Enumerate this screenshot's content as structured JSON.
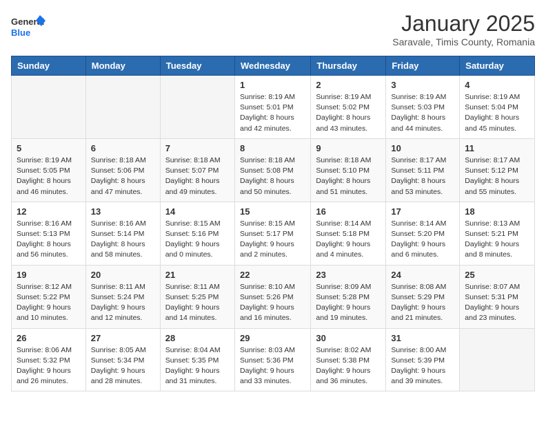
{
  "logo": {
    "general": "General",
    "blue": "Blue"
  },
  "title": "January 2025",
  "subtitle": "Saravale, Timis County, Romania",
  "weekdays": [
    "Sunday",
    "Monday",
    "Tuesday",
    "Wednesday",
    "Thursday",
    "Friday",
    "Saturday"
  ],
  "weeks": [
    [
      {
        "day": "",
        "info": ""
      },
      {
        "day": "",
        "info": ""
      },
      {
        "day": "",
        "info": ""
      },
      {
        "day": "1",
        "info": "Sunrise: 8:19 AM\nSunset: 5:01 PM\nDaylight: 8 hours and 42 minutes."
      },
      {
        "day": "2",
        "info": "Sunrise: 8:19 AM\nSunset: 5:02 PM\nDaylight: 8 hours and 43 minutes."
      },
      {
        "day": "3",
        "info": "Sunrise: 8:19 AM\nSunset: 5:03 PM\nDaylight: 8 hours and 44 minutes."
      },
      {
        "day": "4",
        "info": "Sunrise: 8:19 AM\nSunset: 5:04 PM\nDaylight: 8 hours and 45 minutes."
      }
    ],
    [
      {
        "day": "5",
        "info": "Sunrise: 8:19 AM\nSunset: 5:05 PM\nDaylight: 8 hours and 46 minutes."
      },
      {
        "day": "6",
        "info": "Sunrise: 8:18 AM\nSunset: 5:06 PM\nDaylight: 8 hours and 47 minutes."
      },
      {
        "day": "7",
        "info": "Sunrise: 8:18 AM\nSunset: 5:07 PM\nDaylight: 8 hours and 49 minutes."
      },
      {
        "day": "8",
        "info": "Sunrise: 8:18 AM\nSunset: 5:08 PM\nDaylight: 8 hours and 50 minutes."
      },
      {
        "day": "9",
        "info": "Sunrise: 8:18 AM\nSunset: 5:10 PM\nDaylight: 8 hours and 51 minutes."
      },
      {
        "day": "10",
        "info": "Sunrise: 8:17 AM\nSunset: 5:11 PM\nDaylight: 8 hours and 53 minutes."
      },
      {
        "day": "11",
        "info": "Sunrise: 8:17 AM\nSunset: 5:12 PM\nDaylight: 8 hours and 55 minutes."
      }
    ],
    [
      {
        "day": "12",
        "info": "Sunrise: 8:16 AM\nSunset: 5:13 PM\nDaylight: 8 hours and 56 minutes."
      },
      {
        "day": "13",
        "info": "Sunrise: 8:16 AM\nSunset: 5:14 PM\nDaylight: 8 hours and 58 minutes."
      },
      {
        "day": "14",
        "info": "Sunrise: 8:15 AM\nSunset: 5:16 PM\nDaylight: 9 hours and 0 minutes."
      },
      {
        "day": "15",
        "info": "Sunrise: 8:15 AM\nSunset: 5:17 PM\nDaylight: 9 hours and 2 minutes."
      },
      {
        "day": "16",
        "info": "Sunrise: 8:14 AM\nSunset: 5:18 PM\nDaylight: 9 hours and 4 minutes."
      },
      {
        "day": "17",
        "info": "Sunrise: 8:14 AM\nSunset: 5:20 PM\nDaylight: 9 hours and 6 minutes."
      },
      {
        "day": "18",
        "info": "Sunrise: 8:13 AM\nSunset: 5:21 PM\nDaylight: 9 hours and 8 minutes."
      }
    ],
    [
      {
        "day": "19",
        "info": "Sunrise: 8:12 AM\nSunset: 5:22 PM\nDaylight: 9 hours and 10 minutes."
      },
      {
        "day": "20",
        "info": "Sunrise: 8:11 AM\nSunset: 5:24 PM\nDaylight: 9 hours and 12 minutes."
      },
      {
        "day": "21",
        "info": "Sunrise: 8:11 AM\nSunset: 5:25 PM\nDaylight: 9 hours and 14 minutes."
      },
      {
        "day": "22",
        "info": "Sunrise: 8:10 AM\nSunset: 5:26 PM\nDaylight: 9 hours and 16 minutes."
      },
      {
        "day": "23",
        "info": "Sunrise: 8:09 AM\nSunset: 5:28 PM\nDaylight: 9 hours and 19 minutes."
      },
      {
        "day": "24",
        "info": "Sunrise: 8:08 AM\nSunset: 5:29 PM\nDaylight: 9 hours and 21 minutes."
      },
      {
        "day": "25",
        "info": "Sunrise: 8:07 AM\nSunset: 5:31 PM\nDaylight: 9 hours and 23 minutes."
      }
    ],
    [
      {
        "day": "26",
        "info": "Sunrise: 8:06 AM\nSunset: 5:32 PM\nDaylight: 9 hours and 26 minutes."
      },
      {
        "day": "27",
        "info": "Sunrise: 8:05 AM\nSunset: 5:34 PM\nDaylight: 9 hours and 28 minutes."
      },
      {
        "day": "28",
        "info": "Sunrise: 8:04 AM\nSunset: 5:35 PM\nDaylight: 9 hours and 31 minutes."
      },
      {
        "day": "29",
        "info": "Sunrise: 8:03 AM\nSunset: 5:36 PM\nDaylight: 9 hours and 33 minutes."
      },
      {
        "day": "30",
        "info": "Sunrise: 8:02 AM\nSunset: 5:38 PM\nDaylight: 9 hours and 36 minutes."
      },
      {
        "day": "31",
        "info": "Sunrise: 8:00 AM\nSunset: 5:39 PM\nDaylight: 9 hours and 39 minutes."
      },
      {
        "day": "",
        "info": ""
      }
    ]
  ]
}
